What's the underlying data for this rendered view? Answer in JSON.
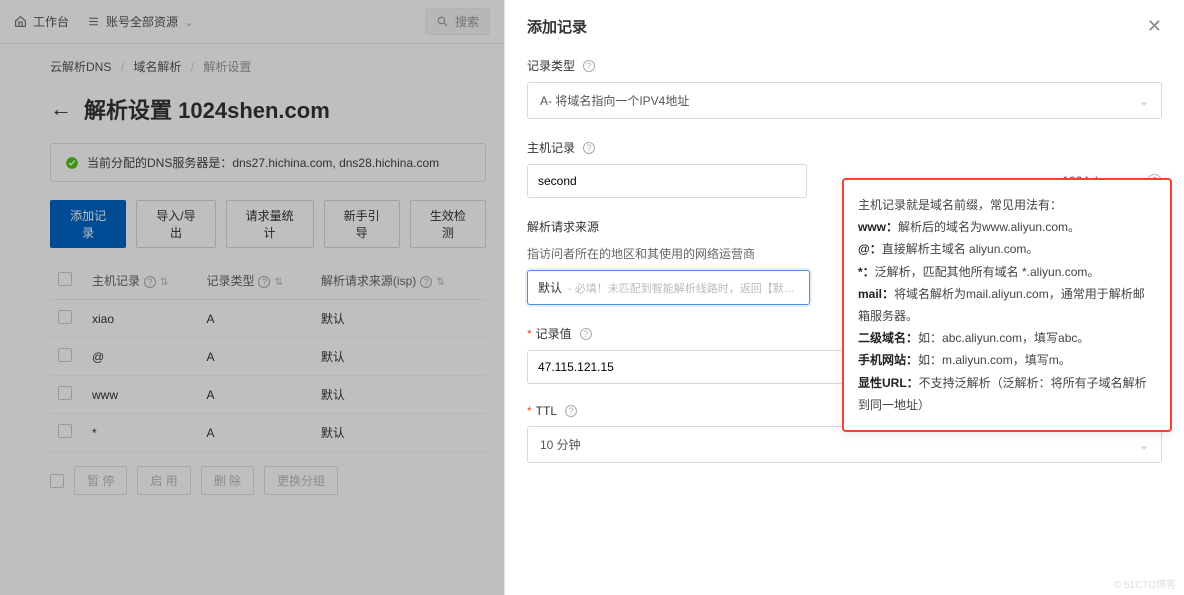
{
  "topbar": {
    "home": "工作台",
    "resource": "账号全部资源",
    "search_placeholder": "搜索"
  },
  "breadcrumb": {
    "a": "云解析DNS",
    "b": "域名解析",
    "c": "解析设置"
  },
  "page": {
    "title_prefix": "解析设置",
    "domain": "1024shen.com",
    "dns_notice": "当前分配的DNS服务器是：dns27.hichina.com, dns28.hichina.com"
  },
  "buttons": {
    "add": "添加记录",
    "import_export": "导入/导出",
    "req_stats": "请求量统计",
    "guide": "新手引导",
    "check": "生效检测"
  },
  "table": {
    "headers": {
      "host": "主机记录",
      "type": "记录类型",
      "isp": "解析请求来源(isp)"
    },
    "rows": [
      {
        "host": "xiao",
        "type": "A",
        "isp": "默认"
      },
      {
        "host": "@",
        "type": "A",
        "isp": "默认"
      },
      {
        "host": "www",
        "type": "A",
        "isp": "默认"
      },
      {
        "host": "*",
        "type": "A",
        "isp": "默认"
      }
    ]
  },
  "bottom_actions": {
    "pause": "暂 停",
    "enable": "启 用",
    "delete": "删 除",
    "regroup": "更换分组"
  },
  "panel": {
    "title": "添加记录",
    "record_type_label": "记录类型",
    "record_type_value": "A- 将域名指向一个IPV4地址",
    "host_label": "主机记录",
    "host_value": "second",
    "domain_suffix": ".1024shen.com",
    "source_label": "解析请求来源",
    "source_desc": "指访问者所在的地区和其使用的网络运营商",
    "source_tag": "默认",
    "source_placeholder": "- 必填！未匹配到智能解析线路时，返回【默认】线路设置结果",
    "value_label": "记录值",
    "value_value": "47.115.121.15",
    "ttl_label": "TTL",
    "ttl_value": "10 分钟"
  },
  "tooltip": {
    "intro": "主机记录就是域名前缀，常见用法有：",
    "www_key": "www：",
    "www_text": "解析后的域名为www.aliyun.com。",
    "at_key": "@：",
    "at_text": "直接解析主域名 aliyun.com。",
    "star_key": "*：",
    "star_text": "泛解析，匹配其他所有域名 *.aliyun.com。",
    "mail_key": "mail：",
    "mail_text": "将域名解析为mail.aliyun.com，通常用于解析邮箱服务器。",
    "sub_key": "二级域名：",
    "sub_text": "如：abc.aliyun.com，填写abc。",
    "mobile_key": "手机网站：",
    "mobile_text": "如：m.aliyun.com，填写m。",
    "url_key": "显性URL：",
    "url_text": "不支持泛解析（泛解析：将所有子域名解析到同一地址）"
  },
  "watermark": "© 51CTO博客"
}
